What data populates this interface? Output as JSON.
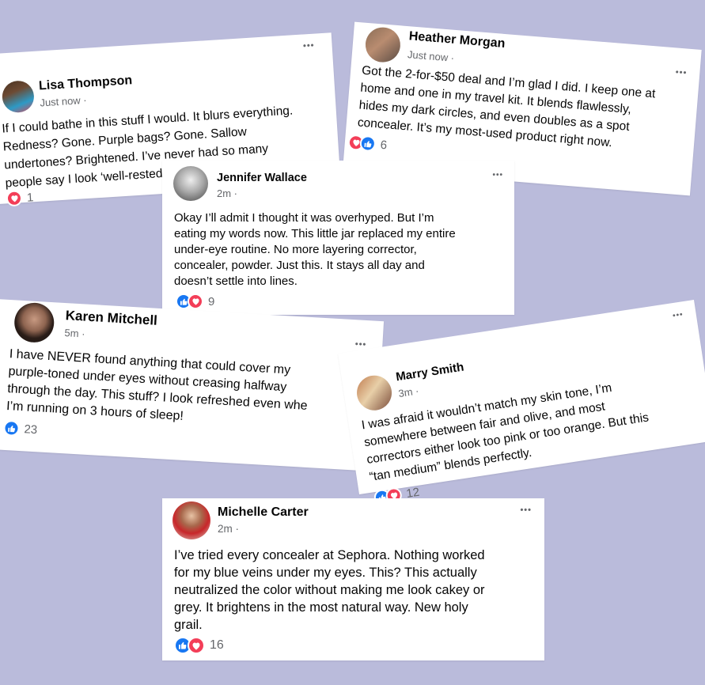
{
  "colors": {
    "background": "#babbdb",
    "card": "#ffffff",
    "name_text": "#050505",
    "meta_text": "#65676b",
    "like_blue": "#1877f2",
    "love_red": "#f33e58"
  },
  "posts": [
    {
      "name": "Lisa Thompson",
      "time": "Just now ·",
      "more": "•••",
      "text": "If I could bathe in this stuff I would. It blurs everything.\nRedness? Gone. Purple bags? Gone. Sallow\nundertones? Brightened. I’ve never had so many\npeople say I look ‘well-rested.’ This is magic.",
      "reactions": [
        "love"
      ],
      "count": "1"
    },
    {
      "name": "Heather Morgan",
      "time": "Just now ·",
      "more": "•••",
      "text": "Got the 2-for-$50 deal and I’m glad I did. I keep one at\nhome and one in my travel kit. It blends flawlessly,\nhides my dark circles, and even doubles as a spot\nconcealer. It’s my most-used product right now.",
      "reactions": [
        "love",
        "like"
      ],
      "count": "6"
    },
    {
      "name": "Jennifer Wallace",
      "time": "2m ·",
      "more": "•••",
      "text": "Okay I’ll admit I thought it was overhyped. But I’m\neating my words now. This little jar replaced my entire\nunder-eye routine. No more layering corrector,\nconcealer, powder. Just this. It stays all day and\ndoesn’t settle into lines.",
      "reactions": [
        "like",
        "love"
      ],
      "count": "9"
    },
    {
      "name": "Karen Mitchell",
      "time": "5m ·",
      "more": "•••",
      "text": "I have NEVER found anything that could cover my\npurple-toned under eyes without creasing halfway\nthrough the day. This stuff? I look refreshed even whe\nI’m running on 3 hours of sleep!",
      "reactions": [
        "like"
      ],
      "count": "23"
    },
    {
      "name": "Marry Smith",
      "time": "3m ·",
      "more": "•••",
      "text": "I was afraid it wouldn’t match my skin tone, I’m\nsomewhere between fair and olive, and most\ncorrectors either look too pink or too orange. But this\n“tan medium” blends perfectly.",
      "reactions": [
        "like",
        "love"
      ],
      "count": "12"
    },
    {
      "name": "Michelle Carter",
      "time": "2m ·",
      "more": "•••",
      "text": "I’ve tried every concealer at Sephora. Nothing worked\nfor my blue veins under my eyes. This? This actually\nneutralized the color without making me look cakey or\ngrey. It brightens in the most natural way. New holy\ngrail.",
      "reactions": [
        "like",
        "love"
      ],
      "count": "16"
    }
  ]
}
